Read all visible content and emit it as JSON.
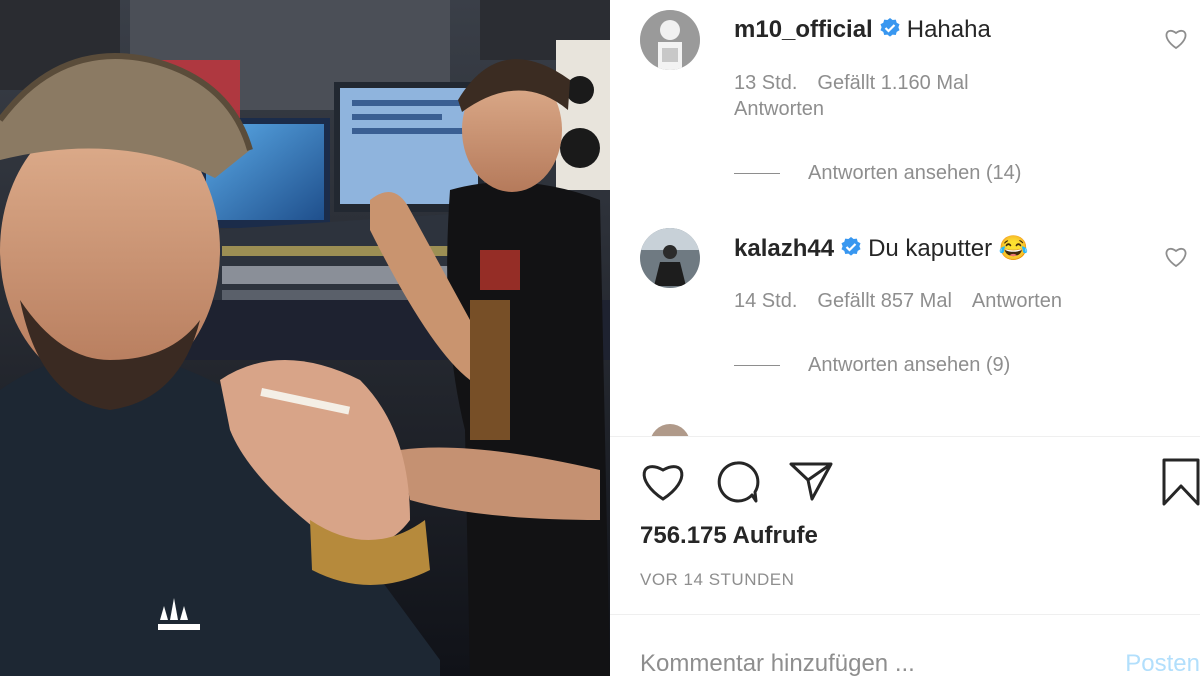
{
  "comments": [
    {
      "username": "m10_official",
      "verified": true,
      "text": "Hahaha",
      "time_ago": "13 Std.",
      "likes": "Gefällt 1.160 Mal",
      "reply_label": "Antworten",
      "view_replies": "Antworten ansehen (14)"
    },
    {
      "username": "kalazh44",
      "verified": true,
      "text": "Du kaputter 😂",
      "time_ago": "14 Std.",
      "likes": "Gefällt 857 Mal",
      "reply_label": "Antworten",
      "view_replies": "Antworten ansehen (9)"
    }
  ],
  "actions": {
    "icons": [
      "heart-icon",
      "comment-icon",
      "share-icon",
      "bookmark-icon"
    ]
  },
  "stats": {
    "views": "756.175 Aufrufe",
    "posted": "VOR 14 STUNDEN"
  },
  "composer": {
    "placeholder": "Kommentar hinzufügen ...",
    "post_label": "Posten"
  },
  "colors": {
    "verified_blue": "#3897f0",
    "meta_gray": "#8e8e8e",
    "post_button_disabled": "#b2dffc"
  }
}
